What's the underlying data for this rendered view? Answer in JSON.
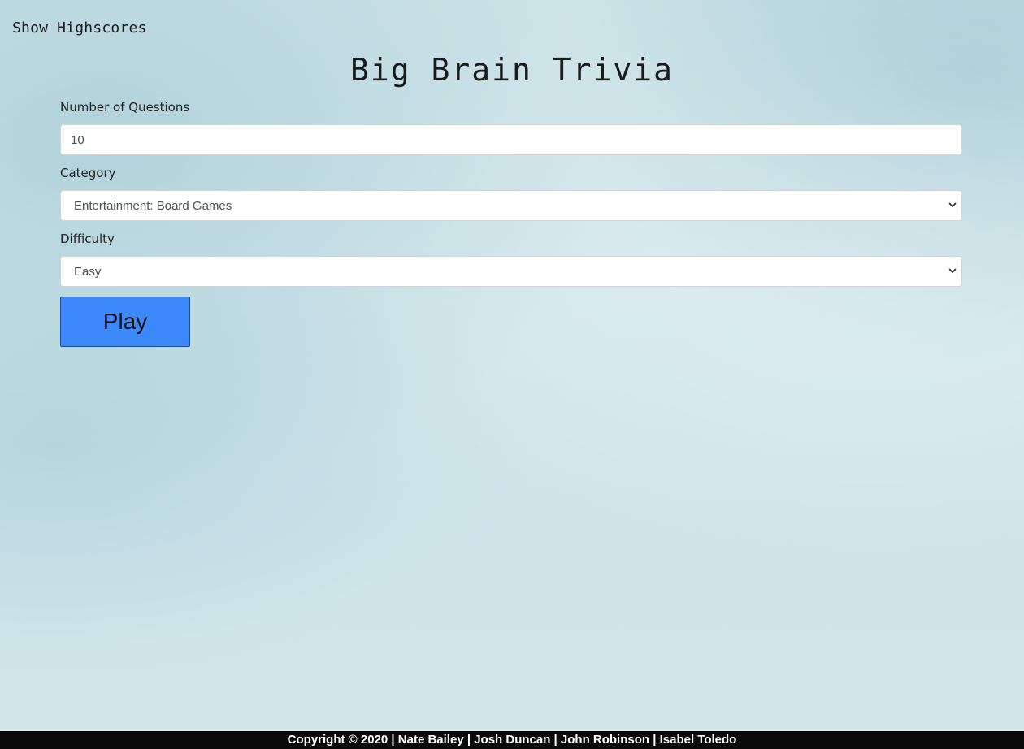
{
  "header": {
    "highscores_link": "Show Highscores",
    "title": "Big Brain Trivia"
  },
  "form": {
    "questions": {
      "label": "Number of Questions",
      "value": "10"
    },
    "category": {
      "label": "Category",
      "selected": "Entertainment: Board Games"
    },
    "difficulty": {
      "label": "Difficulty",
      "selected": "Easy"
    },
    "play_label": "Play"
  },
  "footer": {
    "text": "Copyright © 2020 | Nate Bailey | Josh Duncan | John Robinson | Isabel Toledo"
  },
  "colors": {
    "play_button": "#3b89fa",
    "footer_bg": "#0a0a0a"
  },
  "icons": {
    "select_arrow": "chevron-down-icon"
  }
}
